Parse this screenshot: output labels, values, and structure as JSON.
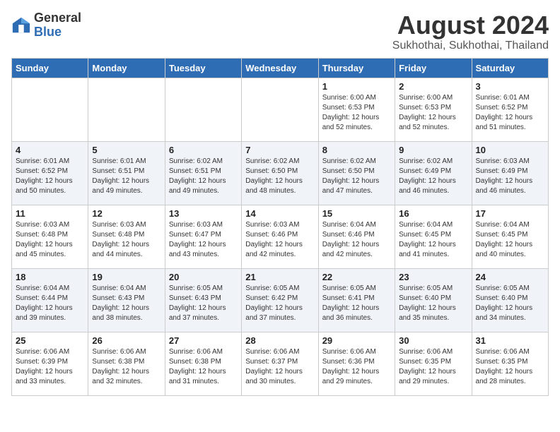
{
  "header": {
    "logo_general": "General",
    "logo_blue": "Blue",
    "month_title": "August 2024",
    "location": "Sukhothai, Sukhothai, Thailand"
  },
  "weekdays": [
    "Sunday",
    "Monday",
    "Tuesday",
    "Wednesday",
    "Thursday",
    "Friday",
    "Saturday"
  ],
  "weeks": [
    [
      {
        "day": "",
        "info": ""
      },
      {
        "day": "",
        "info": ""
      },
      {
        "day": "",
        "info": ""
      },
      {
        "day": "",
        "info": ""
      },
      {
        "day": "1",
        "info": "Sunrise: 6:00 AM\nSunset: 6:53 PM\nDaylight: 12 hours\nand 52 minutes."
      },
      {
        "day": "2",
        "info": "Sunrise: 6:00 AM\nSunset: 6:53 PM\nDaylight: 12 hours\nand 52 minutes."
      },
      {
        "day": "3",
        "info": "Sunrise: 6:01 AM\nSunset: 6:52 PM\nDaylight: 12 hours\nand 51 minutes."
      }
    ],
    [
      {
        "day": "4",
        "info": "Sunrise: 6:01 AM\nSunset: 6:52 PM\nDaylight: 12 hours\nand 50 minutes."
      },
      {
        "day": "5",
        "info": "Sunrise: 6:01 AM\nSunset: 6:51 PM\nDaylight: 12 hours\nand 49 minutes."
      },
      {
        "day": "6",
        "info": "Sunrise: 6:02 AM\nSunset: 6:51 PM\nDaylight: 12 hours\nand 49 minutes."
      },
      {
        "day": "7",
        "info": "Sunrise: 6:02 AM\nSunset: 6:50 PM\nDaylight: 12 hours\nand 48 minutes."
      },
      {
        "day": "8",
        "info": "Sunrise: 6:02 AM\nSunset: 6:50 PM\nDaylight: 12 hours\nand 47 minutes."
      },
      {
        "day": "9",
        "info": "Sunrise: 6:02 AM\nSunset: 6:49 PM\nDaylight: 12 hours\nand 46 minutes."
      },
      {
        "day": "10",
        "info": "Sunrise: 6:03 AM\nSunset: 6:49 PM\nDaylight: 12 hours\nand 46 minutes."
      }
    ],
    [
      {
        "day": "11",
        "info": "Sunrise: 6:03 AM\nSunset: 6:48 PM\nDaylight: 12 hours\nand 45 minutes."
      },
      {
        "day": "12",
        "info": "Sunrise: 6:03 AM\nSunset: 6:48 PM\nDaylight: 12 hours\nand 44 minutes."
      },
      {
        "day": "13",
        "info": "Sunrise: 6:03 AM\nSunset: 6:47 PM\nDaylight: 12 hours\nand 43 minutes."
      },
      {
        "day": "14",
        "info": "Sunrise: 6:03 AM\nSunset: 6:46 PM\nDaylight: 12 hours\nand 42 minutes."
      },
      {
        "day": "15",
        "info": "Sunrise: 6:04 AM\nSunset: 6:46 PM\nDaylight: 12 hours\nand 42 minutes."
      },
      {
        "day": "16",
        "info": "Sunrise: 6:04 AM\nSunset: 6:45 PM\nDaylight: 12 hours\nand 41 minutes."
      },
      {
        "day": "17",
        "info": "Sunrise: 6:04 AM\nSunset: 6:45 PM\nDaylight: 12 hours\nand 40 minutes."
      }
    ],
    [
      {
        "day": "18",
        "info": "Sunrise: 6:04 AM\nSunset: 6:44 PM\nDaylight: 12 hours\nand 39 minutes."
      },
      {
        "day": "19",
        "info": "Sunrise: 6:04 AM\nSunset: 6:43 PM\nDaylight: 12 hours\nand 38 minutes."
      },
      {
        "day": "20",
        "info": "Sunrise: 6:05 AM\nSunset: 6:43 PM\nDaylight: 12 hours\nand 37 minutes."
      },
      {
        "day": "21",
        "info": "Sunrise: 6:05 AM\nSunset: 6:42 PM\nDaylight: 12 hours\nand 37 minutes."
      },
      {
        "day": "22",
        "info": "Sunrise: 6:05 AM\nSunset: 6:41 PM\nDaylight: 12 hours\nand 36 minutes."
      },
      {
        "day": "23",
        "info": "Sunrise: 6:05 AM\nSunset: 6:40 PM\nDaylight: 12 hours\nand 35 minutes."
      },
      {
        "day": "24",
        "info": "Sunrise: 6:05 AM\nSunset: 6:40 PM\nDaylight: 12 hours\nand 34 minutes."
      }
    ],
    [
      {
        "day": "25",
        "info": "Sunrise: 6:06 AM\nSunset: 6:39 PM\nDaylight: 12 hours\nand 33 minutes."
      },
      {
        "day": "26",
        "info": "Sunrise: 6:06 AM\nSunset: 6:38 PM\nDaylight: 12 hours\nand 32 minutes."
      },
      {
        "day": "27",
        "info": "Sunrise: 6:06 AM\nSunset: 6:38 PM\nDaylight: 12 hours\nand 31 minutes."
      },
      {
        "day": "28",
        "info": "Sunrise: 6:06 AM\nSunset: 6:37 PM\nDaylight: 12 hours\nand 30 minutes."
      },
      {
        "day": "29",
        "info": "Sunrise: 6:06 AM\nSunset: 6:36 PM\nDaylight: 12 hours\nand 29 minutes."
      },
      {
        "day": "30",
        "info": "Sunrise: 6:06 AM\nSunset: 6:35 PM\nDaylight: 12 hours\nand 29 minutes."
      },
      {
        "day": "31",
        "info": "Sunrise: 6:06 AM\nSunset: 6:35 PM\nDaylight: 12 hours\nand 28 minutes."
      }
    ]
  ]
}
